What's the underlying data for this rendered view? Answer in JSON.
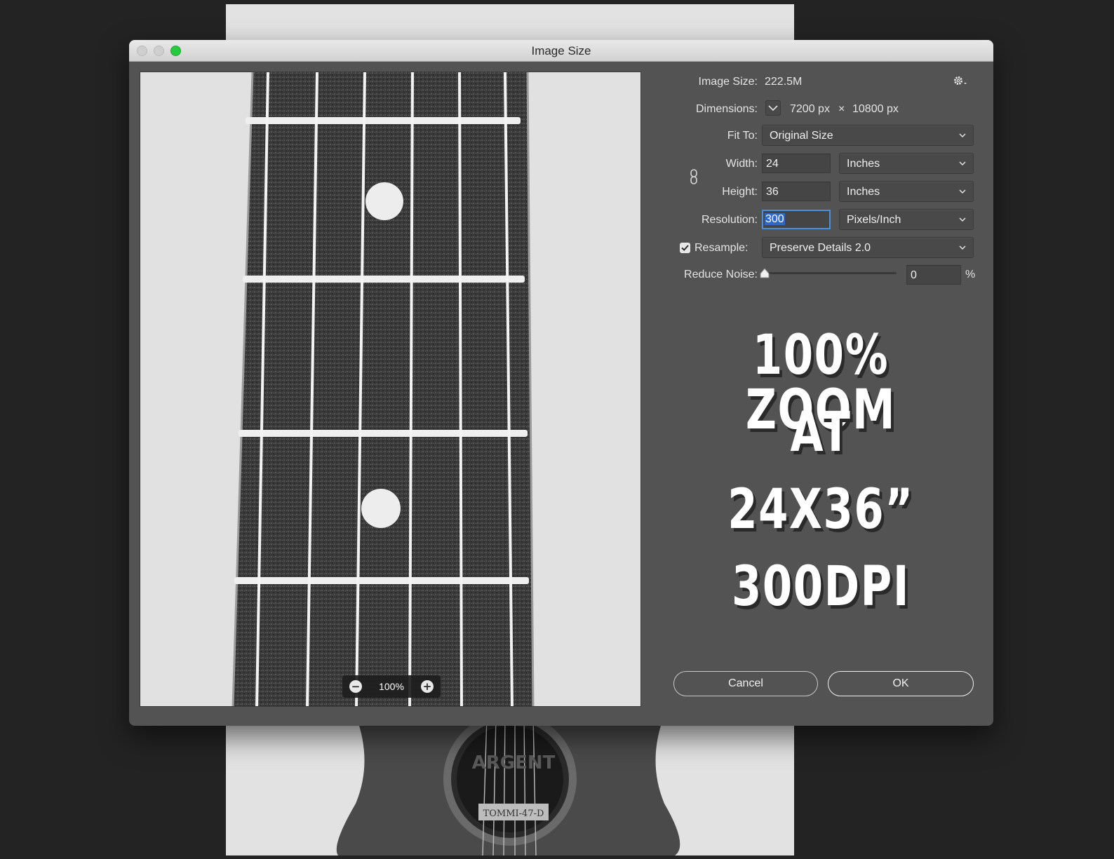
{
  "window": {
    "title": "Image Size"
  },
  "image_size": {
    "label": "Image Size:",
    "value": "222.5M"
  },
  "dimensions": {
    "label": "Dimensions:",
    "width": "7200 px",
    "times": "×",
    "height": "10800 px"
  },
  "fit_to": {
    "label": "Fit To:",
    "value": "Original Size"
  },
  "width": {
    "label": "Width:",
    "value": "24",
    "unit": "Inches"
  },
  "height": {
    "label": "Height:",
    "value": "36",
    "unit": "Inches"
  },
  "resolution": {
    "label": "Resolution:",
    "value": "300",
    "unit": "Pixels/Inch"
  },
  "resample": {
    "label": "Resample:",
    "checked": true,
    "value": "Preserve Details 2.0"
  },
  "reduce_noise": {
    "label": "Reduce Noise:",
    "value": "0",
    "unit": "%",
    "level": 0
  },
  "preview": {
    "zoom": "100%",
    "zoom_out": "−",
    "zoom_in": "+"
  },
  "overlay": {
    "line1": "100% ZOOM",
    "line2": "AT",
    "line3": "24X36”",
    "line4": "300DPI"
  },
  "buttons": {
    "cancel": "Cancel",
    "ok": "OK"
  },
  "background_photo": {
    "soundhole_text_1": "ARGENT",
    "soundhole_text_2": "TOMMI-47-D"
  },
  "colors": {
    "dialog_bg": "#535353",
    "accent": "#4a8fdc",
    "maximize": "#27c93f"
  }
}
